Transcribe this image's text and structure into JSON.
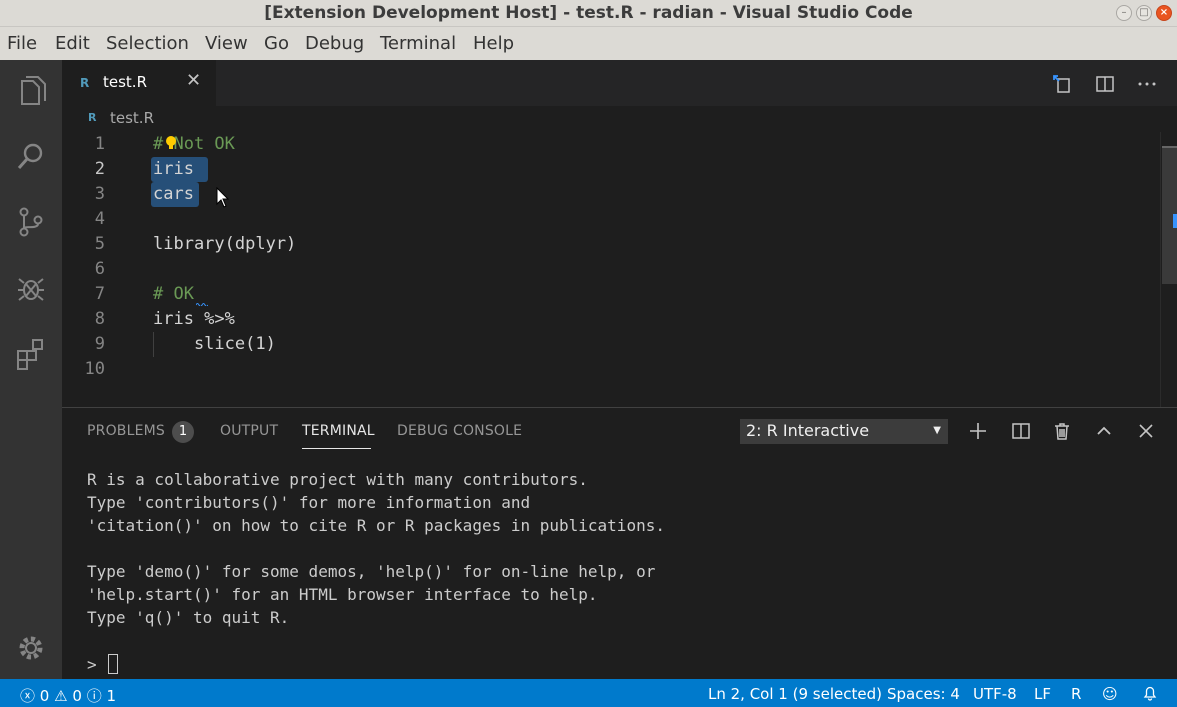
{
  "window": {
    "title": "[Extension Development Host] - test.R - radian - Visual Studio Code"
  },
  "menu": [
    "File",
    "Edit",
    "Selection",
    "View",
    "Go",
    "Debug",
    "Terminal",
    "Help"
  ],
  "activity_bar": {
    "items": [
      "files-icon",
      "search-icon",
      "source-control-icon",
      "debug-icon",
      "extensions-icon"
    ],
    "bottom": "gear-icon"
  },
  "editor": {
    "tab": {
      "label": "test.R",
      "icon": "R"
    },
    "breadcrumb": "test.R",
    "lines": [
      {
        "num": "1",
        "text": "# Not OK"
      },
      {
        "num": "2",
        "text": "iris"
      },
      {
        "num": "3",
        "text": "cars"
      },
      {
        "num": "4",
        "text": ""
      },
      {
        "num": "5",
        "text": "library(dplyr)"
      },
      {
        "num": "6",
        "text": ""
      },
      {
        "num": "7",
        "text": "# OK"
      },
      {
        "num": "8",
        "text": "iris %>%"
      },
      {
        "num": "9",
        "text": "    slice(1)"
      },
      {
        "num": "10",
        "text": ""
      }
    ]
  },
  "panel": {
    "tabs": {
      "problems": "PROBLEMS",
      "problems_count": "1",
      "output": "OUTPUT",
      "terminal": "TERMINAL",
      "debug_console": "DEBUG CONSOLE"
    },
    "terminal_select": "2: R Interactive",
    "terminal_lines": [
      "R is a collaborative project with many contributors.",
      "Type 'contributors()' for more information and",
      "'citation()' on how to cite R or R packages in publications.",
      "",
      "Type 'demo()' for some demos, 'help()' for on-line help, or",
      "'help.start()' for an HTML browser interface to help.",
      "Type 'q()' to quit R.",
      ""
    ],
    "prompt": "> "
  },
  "status": {
    "errors": "0",
    "warnings": "0",
    "infos": "1",
    "position": "Ln 2, Col 1 (9 selected)",
    "spaces": "Spaces: 4",
    "encoding": "UTF-8",
    "eol": "LF",
    "language": "R"
  },
  "colors": {
    "accent": "#007acc",
    "selection": "#264f78",
    "comment": "#6a9955"
  }
}
